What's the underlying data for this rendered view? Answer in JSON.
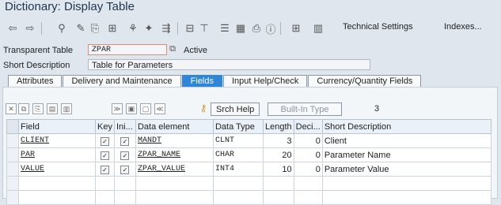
{
  "window": {
    "title": "Dictionary: Display Table"
  },
  "toolbar": {
    "technical_settings": "Technical Settings",
    "indexes": "Indexes..."
  },
  "header": {
    "transparent_table_label": "Transparent Table",
    "table_name": "ZPAR",
    "status": "Active",
    "short_description_label": "Short Description",
    "short_description_value": "Table for Parameters"
  },
  "tabs": [
    {
      "label": "Attributes"
    },
    {
      "label": "Delivery and Maintenance"
    },
    {
      "label": "Fields"
    },
    {
      "label": "Input Help/Check"
    },
    {
      "label": "Currency/Quantity Fields"
    }
  ],
  "fields_toolbar": {
    "srch_help": "Srch Help",
    "builtin_type": "Built-In Type",
    "count": "3"
  },
  "columns": [
    "Field",
    "Key",
    "Ini...",
    "Data element",
    "Data Type",
    "Length",
    "Deci...",
    "Short Description"
  ],
  "rows": [
    {
      "field": "CLIENT",
      "key": "✓",
      "init": "✓",
      "element": "MANDT",
      "dtype": "CLNT",
      "length": "3",
      "dec": "0",
      "desc": "Client"
    },
    {
      "field": "PAR",
      "key": "✓",
      "init": "✓",
      "element": "ZPAR_NAME",
      "dtype": "CHAR",
      "length": "20",
      "dec": "0",
      "desc": "Parameter Name"
    },
    {
      "field": "VALUE",
      "key": "✓",
      "init": "✓",
      "element": "ZPAR_VALUE",
      "dtype": "INT4",
      "length": "10",
      "dec": "0",
      "desc": "Parameter Value"
    }
  ]
}
